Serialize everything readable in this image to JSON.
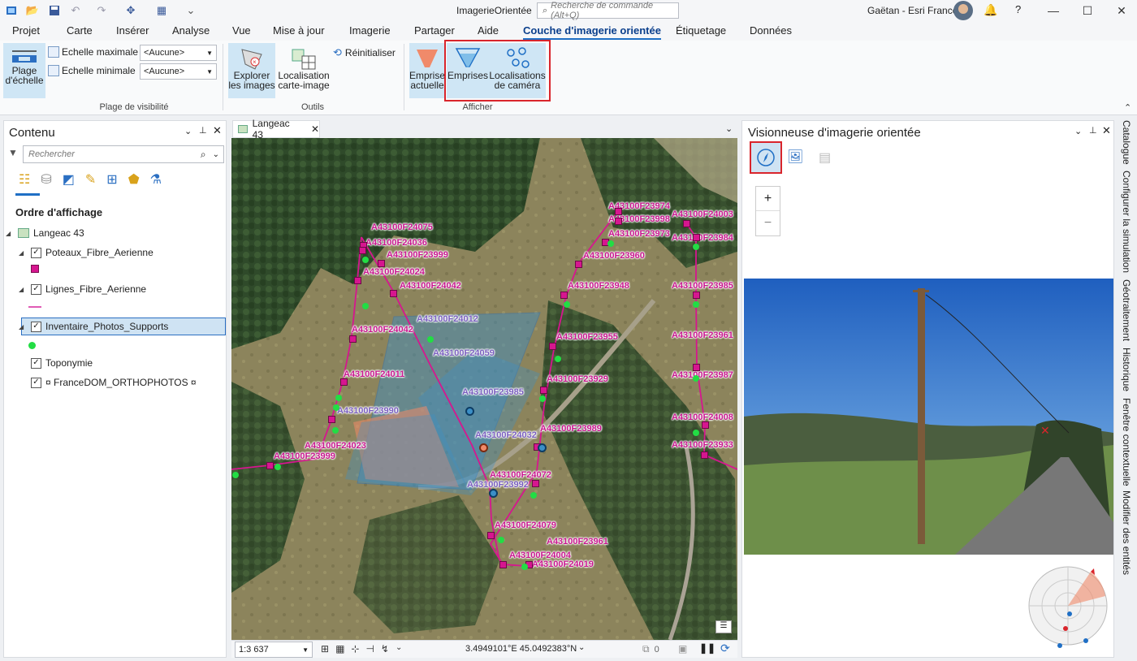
{
  "app": {
    "title": "ImagerieOrientée",
    "command_search_placeholder": "Recherche de commande (Alt+Q)",
    "user": "Gaëtan - Esri France"
  },
  "menu": [
    "Projet",
    "Carte",
    "Insérer",
    "Analyse",
    "Vue",
    "Mise à jour",
    "Imagerie",
    "Partager",
    "Aide",
    "Couche d'imagerie orientée",
    "Étiquetage",
    "Données"
  ],
  "active_menu": "Couche d'imagerie orientée",
  "ribbon": {
    "plage_echelle": "Plage d'échelle",
    "echelle_max_label": "Echelle maximale",
    "echelle_min_label": "Echelle minimale",
    "echelle_max_value": "<Aucune>",
    "echelle_min_value": "<Aucune>",
    "group_visibilite": "Plage de visibilité",
    "explorer": "Explorer les images",
    "localisation": "Localisation carte-image",
    "reinitialiser": "Réinitialiser",
    "group_outils": "Outils",
    "emprise_actuelle": "Emprise actuelle",
    "emprises": "Emprises",
    "localisations": "Localisations de caméra",
    "group_afficher": "Afficher"
  },
  "contents": {
    "title": "Contenu",
    "search_placeholder": "Rechercher",
    "section": "Ordre d'affichage",
    "map_name": "Langeac 43",
    "layers": [
      "Poteaux_Fibre_Aerienne",
      "Lignes_Fibre_Aerienne",
      "Inventaire_Photos_Supports",
      "Toponymie",
      "¤ FranceDOM_ORTHOPHOTOS ¤"
    ]
  },
  "map": {
    "tab": "Langeac 43",
    "scale": "1:3 637",
    "coords": "3.4949101°E 45.0492383°N",
    "sel_count": "0",
    "labels_pink": [
      "A43100F24075",
      "A43100F24036",
      "A43100F23999",
      "A43100F24024",
      "A43100F24042",
      "A43100F24042",
      "A43100F24011",
      "A43100F24023",
      "A43100F23999",
      "A43100F23974",
      "A43100F23998",
      "A43100F23973",
      "A43100F23960",
      "A43100F23948",
      "A43100F23955",
      "A43100F23929",
      "A43100F23989",
      "A43100F24072",
      "A43100F24079",
      "A43100F23961",
      "A43100F24004",
      "A43100F24019",
      "A43100F24003",
      "A43100F23984",
      "A43100F23985",
      "A43100F23961",
      "A43100F23987",
      "A43100F24008",
      "A43100F23933"
    ],
    "labels_purple": [
      "A43100F24012",
      "A43100F24059",
      "A43100F23985",
      "A43100F23990",
      "A43100F24032",
      "A43100F23992"
    ]
  },
  "viewer": {
    "title": "Visionneuse d'imagerie orientée",
    "zoom_in": "+",
    "zoom_out": "−"
  },
  "side_tabs": [
    "Catalogue",
    "Configurer la simulation",
    "Géotraitement",
    "Historique",
    "Fenêtre contextuelle",
    "Modifier des entités"
  ],
  "colors": {
    "accent": "#1f6fc5",
    "highlight": "#d9252c",
    "pink": "#d6168f",
    "point": "#22dd44"
  }
}
